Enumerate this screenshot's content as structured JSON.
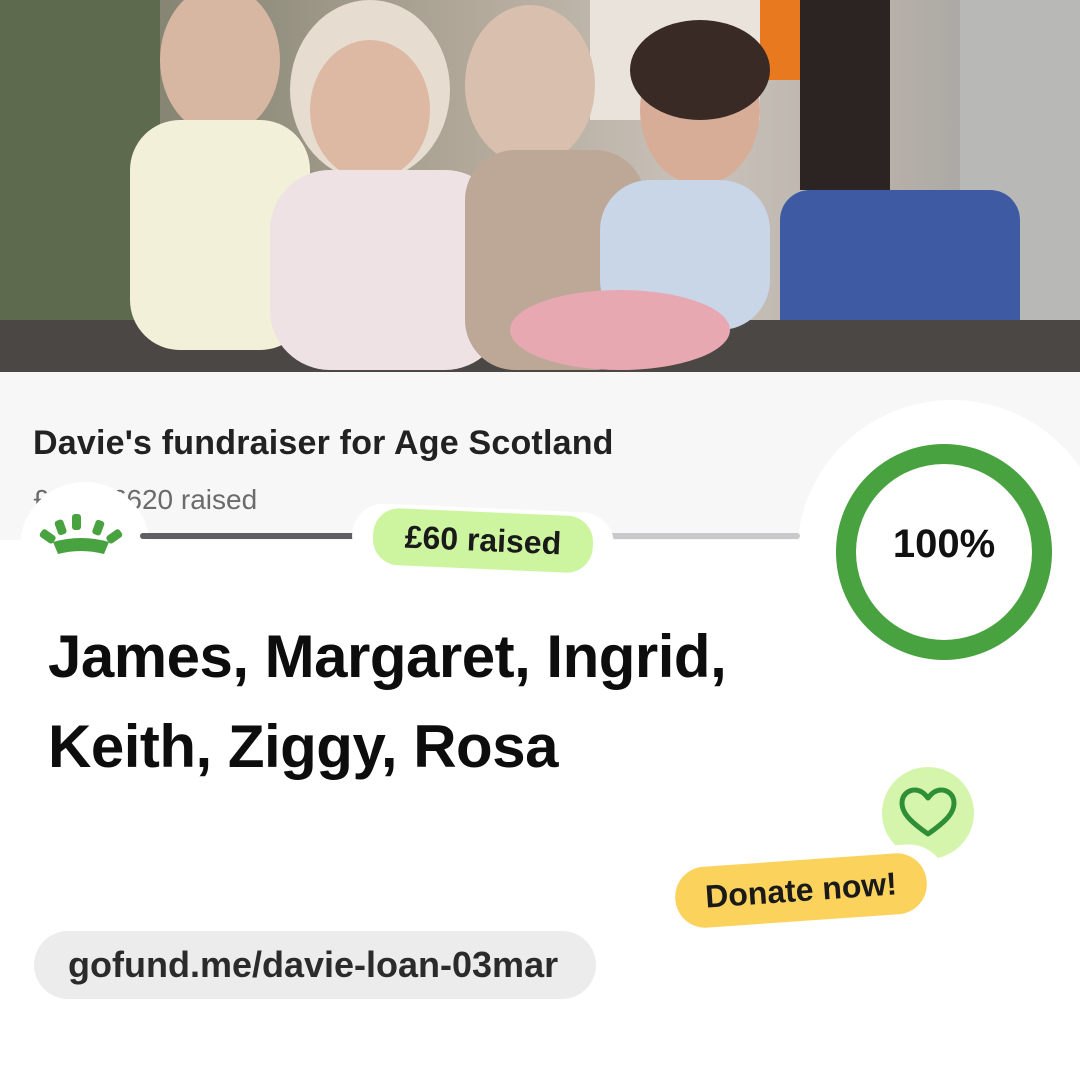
{
  "hero": {
    "photo_name": "family-photo",
    "colors": {
      "accent_green": "#48a23f",
      "badge_green": "#cdf5a0",
      "donate_yellow": "#fbd35c",
      "heart_bg": "#d5f5ad"
    }
  },
  "card": {
    "title": "Davie's fundraiser for Age Scotland",
    "subtitle": "£... of £620 raised"
  },
  "progress": {
    "fraction": 0.6,
    "raised_badge": "£60 raised",
    "percent": 1.0,
    "percent_label": "100%"
  },
  "main": {
    "names_line1": "James, Margaret, Ingrid,",
    "names_line2": "Keith, Ziggy, Rosa"
  },
  "actions": {
    "donate_label": "Donate now!",
    "heart_icon": "heart-icon",
    "logo_icon": "gofundme-sun-icon"
  },
  "footer": {
    "url": "gofund.me/davie-loan-03mar"
  }
}
